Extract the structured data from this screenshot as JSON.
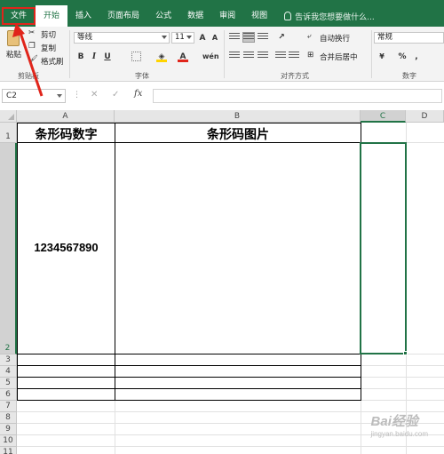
{
  "menu": {
    "tabs": [
      {
        "label": "文件"
      },
      {
        "label": "开始"
      },
      {
        "label": "插入"
      },
      {
        "label": "页面布局"
      },
      {
        "label": "公式"
      },
      {
        "label": "数据"
      },
      {
        "label": "审阅"
      },
      {
        "label": "视图"
      }
    ],
    "tell_me": "告诉我您想要做什么..."
  },
  "ribbon": {
    "clipboard": {
      "paste": "粘贴",
      "cut": "剪切",
      "copy": "复制",
      "format_painter": "格式刷",
      "group": "剪贴板"
    },
    "font": {
      "name": "等线",
      "size": "11",
      "grow": "A",
      "shrink": "A",
      "bold": "B",
      "italic": "I",
      "underline": "U",
      "group": "字体"
    },
    "alignment": {
      "wrap_text": "自动换行",
      "merge_center": "合并后居中",
      "group": "对齐方式"
    },
    "number": {
      "format": "常规",
      "percent": "%",
      "comma": ",",
      "group": "数字"
    }
  },
  "formula_bar": {
    "name_box": "C2",
    "fx": "fx",
    "cancel": "✕",
    "enter": "✓",
    "value": ""
  },
  "sheet": {
    "columns": [
      "A",
      "B",
      "C",
      "D"
    ],
    "rows": [
      "1",
      "2",
      "3",
      "4",
      "5",
      "6",
      "7",
      "8",
      "9",
      "10",
      "11"
    ],
    "selected_cell": "C2",
    "cells": {
      "A1": "条形码数字",
      "B1": "条形码图片",
      "A2": "1234567890"
    }
  },
  "watermark": {
    "text": "Bai经验",
    "sub": "jingyan.baidu.com"
  },
  "colors": {
    "excel_green": "#217346",
    "annotation_red": "#e0251b"
  }
}
